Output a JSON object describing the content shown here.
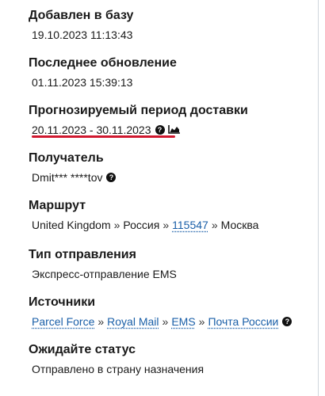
{
  "accent_color": "#1a5fa8",
  "highlight_color": "#d0182f",
  "added": {
    "label": "Добавлен в базу",
    "value": "19.10.2023 11:13:43"
  },
  "updated": {
    "label": "Последнее обновление",
    "value": "01.11.2023 15:39:13"
  },
  "delivery": {
    "label": "Прогнозируемый период доставки",
    "value": "20.11.2023 - 30.11.2023",
    "help_icon": "question-circle-icon",
    "chart_icon": "area-chart-icon"
  },
  "recipient": {
    "label": "Получатель",
    "value": "Dmit*** ****tov",
    "help_icon": "question-circle-icon"
  },
  "route": {
    "label": "Маршрут",
    "origin": "United Kingdom",
    "country": "Россия",
    "postcode": "115547",
    "city": "Москва",
    "separator": "»"
  },
  "shipment_type": {
    "label": "Тип отправления",
    "value": "Экспресс-отправление EMS"
  },
  "sources": {
    "label": "Источники",
    "items": [
      "Parcel Force",
      "Royal Mail",
      "EMS",
      "Почта России"
    ],
    "separator": "»",
    "help_icon": "question-circle-icon"
  },
  "status": {
    "label": "Ожидайте статус",
    "value": "Отправлено в страну назначения"
  }
}
